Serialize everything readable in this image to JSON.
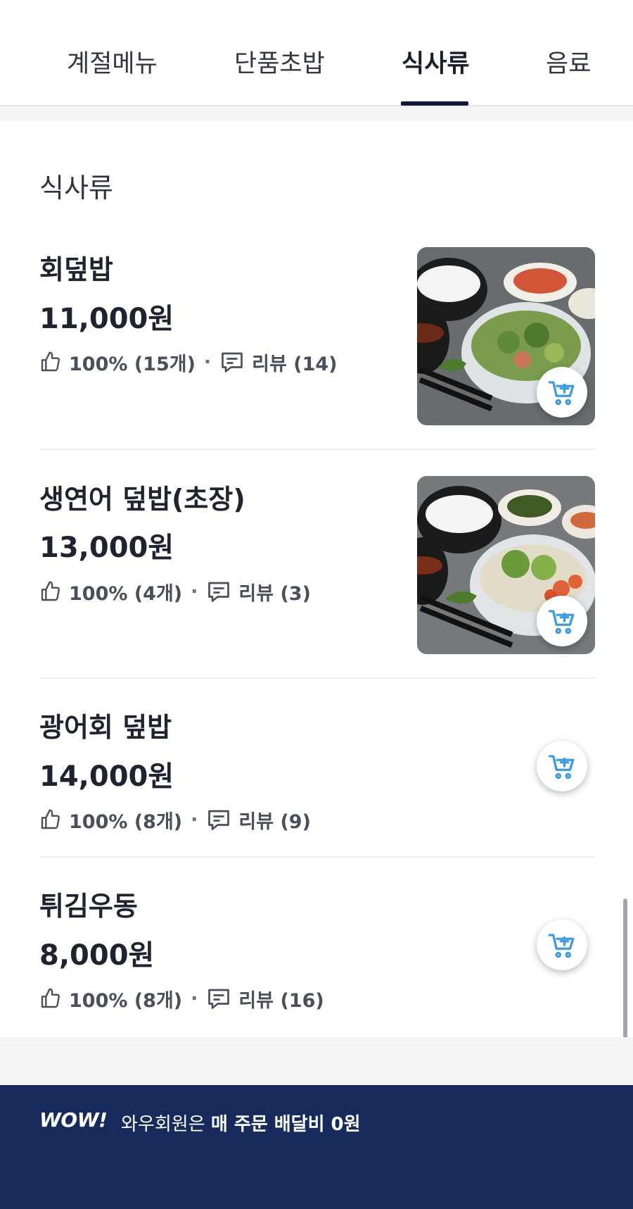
{
  "tabs": [
    {
      "label": "계절메뉴",
      "active": false
    },
    {
      "label": "단품초밥",
      "active": false
    },
    {
      "label": "식사류",
      "active": true
    },
    {
      "label": "음료",
      "active": false
    }
  ],
  "section": {
    "title": "식사류"
  },
  "items": [
    {
      "name": "회덮밥",
      "price": "11,000원",
      "rating": "100% (15개)",
      "reviews": "리뷰 (14)",
      "has_image": true
    },
    {
      "name": "생연어 덮밥(초장)",
      "price": "13,000원",
      "rating": "100% (4개)",
      "reviews": "리뷰 (3)",
      "has_image": true
    },
    {
      "name": "광어회 덮밥",
      "price": "14,000원",
      "rating": "100% (8개)",
      "reviews": "리뷰 (9)",
      "has_image": false
    },
    {
      "name": "튀김우동",
      "price": "8,000원",
      "rating": "100% (8개)",
      "reviews": "리뷰 (16)",
      "has_image": false
    }
  ],
  "meta_separator": "·",
  "banner": {
    "logo": "WOW!",
    "text_prefix": "와우회원은 ",
    "text_bold": "매 주문 배달비 0원"
  },
  "colors": {
    "accent_tab_underline": "#14193a",
    "cart_icon": "#3d9be0",
    "banner_bg": "#172a5c"
  },
  "icons": {
    "rating": "thumbs-up-icon",
    "reviews": "comment-icon",
    "cart": "cart-plus-icon"
  }
}
